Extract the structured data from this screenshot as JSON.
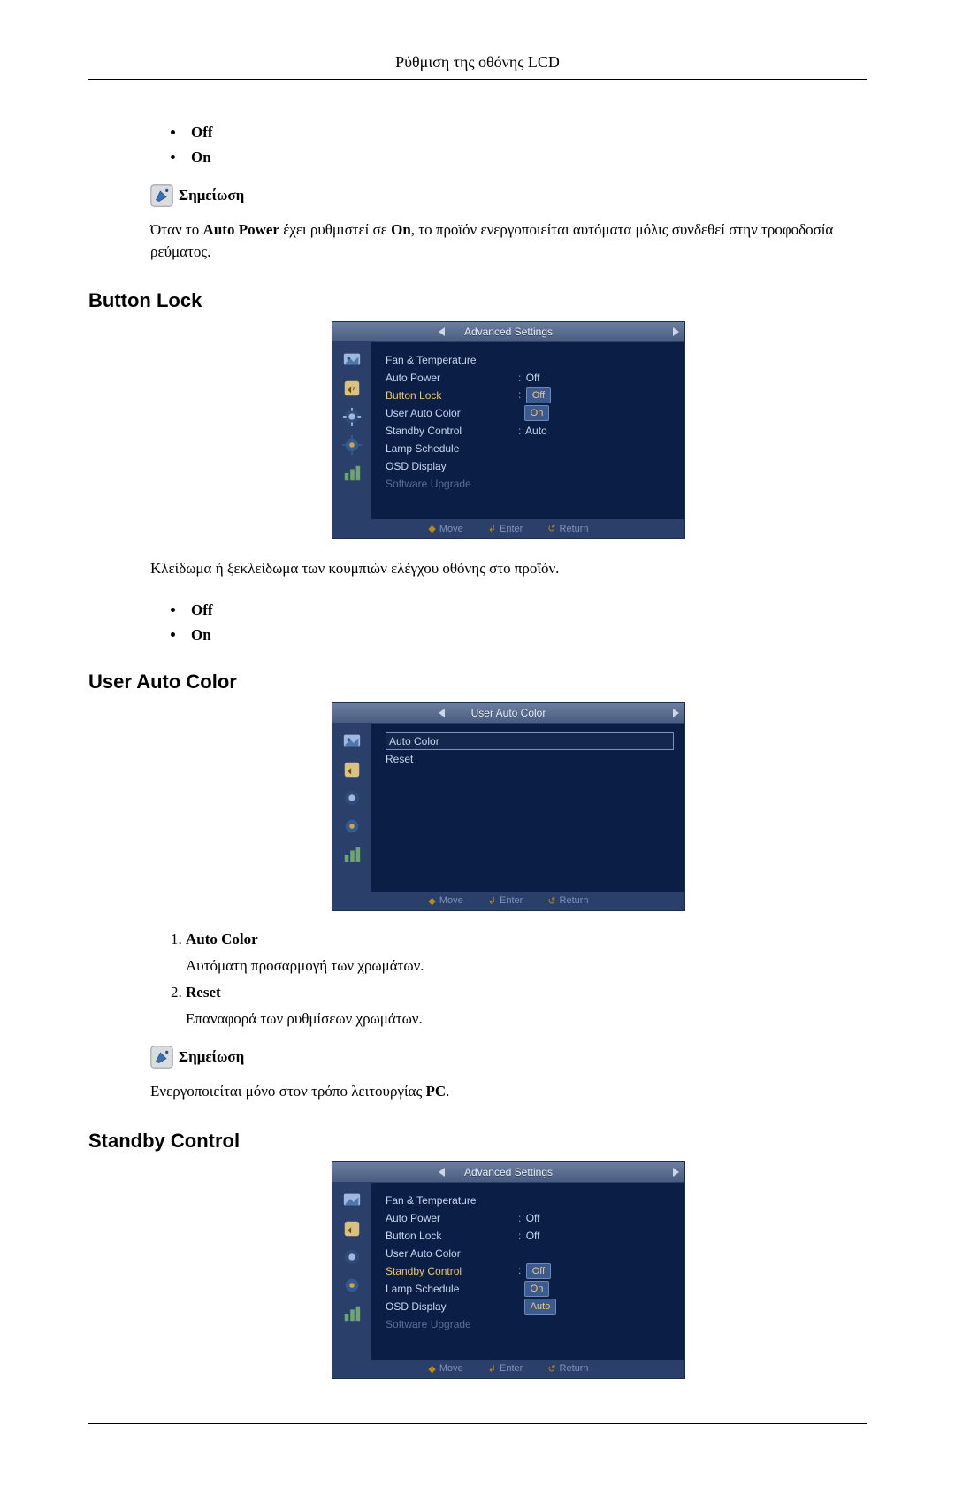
{
  "header": {
    "title": "Ρύθμιση της οθόνης LCD"
  },
  "sec1": {
    "bullets": [
      "Off",
      "On"
    ],
    "note_label": "Σημείωση",
    "note_inline_pre": "Όταν το ",
    "note_b1": "Auto Power",
    "note_mid": " έχει ρυθμιστεί σε ",
    "note_b2": "On",
    "note_post": ", το προϊόν ενεργοποιείται αυτόματα μόλις συνδεθεί στην τροφοδοσία ρεύματος."
  },
  "sec_button_lock": {
    "heading": "Button Lock",
    "desc": "Κλείδωμα ή ξεκλείδωμα των κουμπιών ελέγχου οθόνης στο προϊόν.",
    "bullets": [
      "Off",
      "On"
    ]
  },
  "sec_user_auto_color": {
    "heading": "User Auto Color",
    "items": [
      {
        "term": "Auto Color",
        "desc": "Αυτόματη προσαρμογή των χρωμάτων."
      },
      {
        "term": "Reset",
        "desc": "Επαναφορά των ρυθμίσεων χρωμάτων."
      }
    ],
    "note_label": "Σημείωση",
    "note_text_pre": "Ενεργοποιείται μόνο στον τρόπο λειτουργίας ",
    "note_b": "PC",
    "note_text_post": "."
  },
  "sec_standby": {
    "heading": "Standby Control"
  },
  "osd_advanced_1": {
    "title": "Advanced Settings",
    "rows": [
      {
        "label": "Fan & Temperature",
        "value": ""
      },
      {
        "label": "Auto Power",
        "value": "Off"
      },
      {
        "label": "Button Lock",
        "value": "Off",
        "highlight_label": true,
        "value_box": true
      },
      {
        "label": "User Auto Color",
        "value": "On",
        "value_box": true
      },
      {
        "label": "Standby Control",
        "value": "Auto"
      },
      {
        "label": "Lamp Schedule",
        "value": ""
      },
      {
        "label": "OSD Display",
        "value": ""
      },
      {
        "label": "Software Upgrade",
        "value": "",
        "dim": true
      }
    ],
    "footer": {
      "move": "Move",
      "enter": "Enter",
      "return": "Return"
    }
  },
  "osd_user_auto_color": {
    "title": "User Auto Color",
    "rows": [
      {
        "label": "Auto Color",
        "selected": true
      },
      {
        "label": "Reset"
      }
    ],
    "footer": {
      "move": "Move",
      "enter": "Enter",
      "return": "Return"
    }
  },
  "osd_advanced_2": {
    "title": "Advanced Settings",
    "rows": [
      {
        "label": "Fan & Temperature",
        "value": ""
      },
      {
        "label": "Auto Power",
        "value": "Off"
      },
      {
        "label": "Button Lock",
        "value": "Off"
      },
      {
        "label": "User Auto Color",
        "value": ""
      },
      {
        "label": "Standby Control",
        "value": "Off",
        "highlight_label": true,
        "value_box": true
      },
      {
        "label": "Lamp Schedule",
        "value": "On",
        "value_box": true
      },
      {
        "label": "OSD Display",
        "value": "Auto",
        "value_box": true
      },
      {
        "label": "Software Upgrade",
        "value": "",
        "dim": true
      }
    ],
    "footer": {
      "move": "Move",
      "enter": "Enter",
      "return": "Return"
    }
  }
}
